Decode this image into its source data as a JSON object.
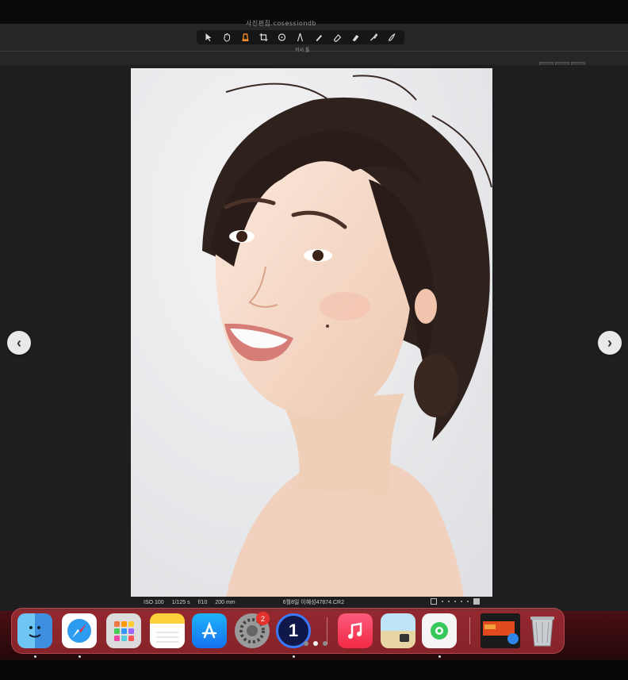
{
  "window": {
    "title": "사진편집.cosessiondb"
  },
  "toolbar": {
    "tools": [
      "select-tool",
      "hand-tool",
      "cursor-tool",
      "crop-tool",
      "rotate-tool",
      "straighten-tool",
      "brush-tool",
      "eraser-tool",
      "gradient-tool",
      "picker-tool",
      "annotate-tool"
    ],
    "active_tool": "cursor-tool",
    "active_label": "커서 툴"
  },
  "status": {
    "iso": "ISO 100",
    "shutter": "1/125 s",
    "aperture": "f/10",
    "focal": "200 mm",
    "filename": "6월8일 이혜성47874.CR2"
  },
  "nav": {
    "prev": "‹",
    "next": "›"
  },
  "dock": {
    "apps": [
      "Finder",
      "Safari",
      "Launchpad",
      "Notes",
      "App Store",
      "System Settings",
      "Capture One",
      "Music",
      "Preview",
      "Find My",
      "Downloads",
      "Trash"
    ],
    "settings_badge": "2",
    "capture_one_label": "1"
  },
  "colors": {
    "accent": "#f08a24",
    "dock": "#c83c46",
    "badge": "#e5322d"
  }
}
